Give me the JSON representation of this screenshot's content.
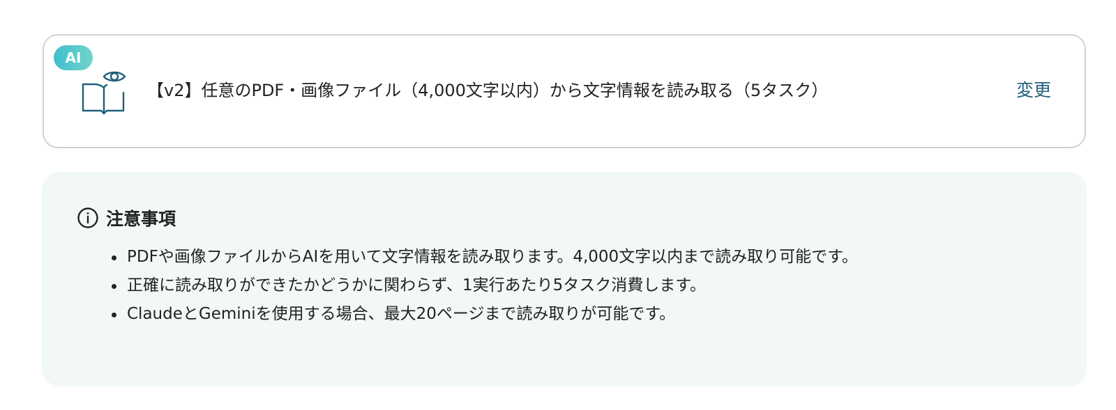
{
  "action": {
    "badge": "AI",
    "icon": "book-eye-icon",
    "title": "【v2】任意のPDF・画像ファイル（4,000文字以内）から文字情報を読み取る（5タスク）",
    "change_label": "変更"
  },
  "notice": {
    "icon": "info-icon",
    "title": "注意事項",
    "items": [
      "PDFや画像ファイルからAIを用いて文字情報を読み取ります。4,000文字以内まで読み取り可能です。",
      "正確に読み取りができたかどうかに関わらず、1実行あたり5タスク消費します。",
      "ClaudeとGeminiを使用する場合、最大20ページまで読み取りが可能です。"
    ]
  },
  "colors": {
    "accent": "#1f5f7a",
    "badge_gradient_start": "#3fbfcf",
    "badge_gradient_end": "#74d3c8",
    "notice_background": "#f2f8f8",
    "card_border": "#d2d2d2"
  }
}
